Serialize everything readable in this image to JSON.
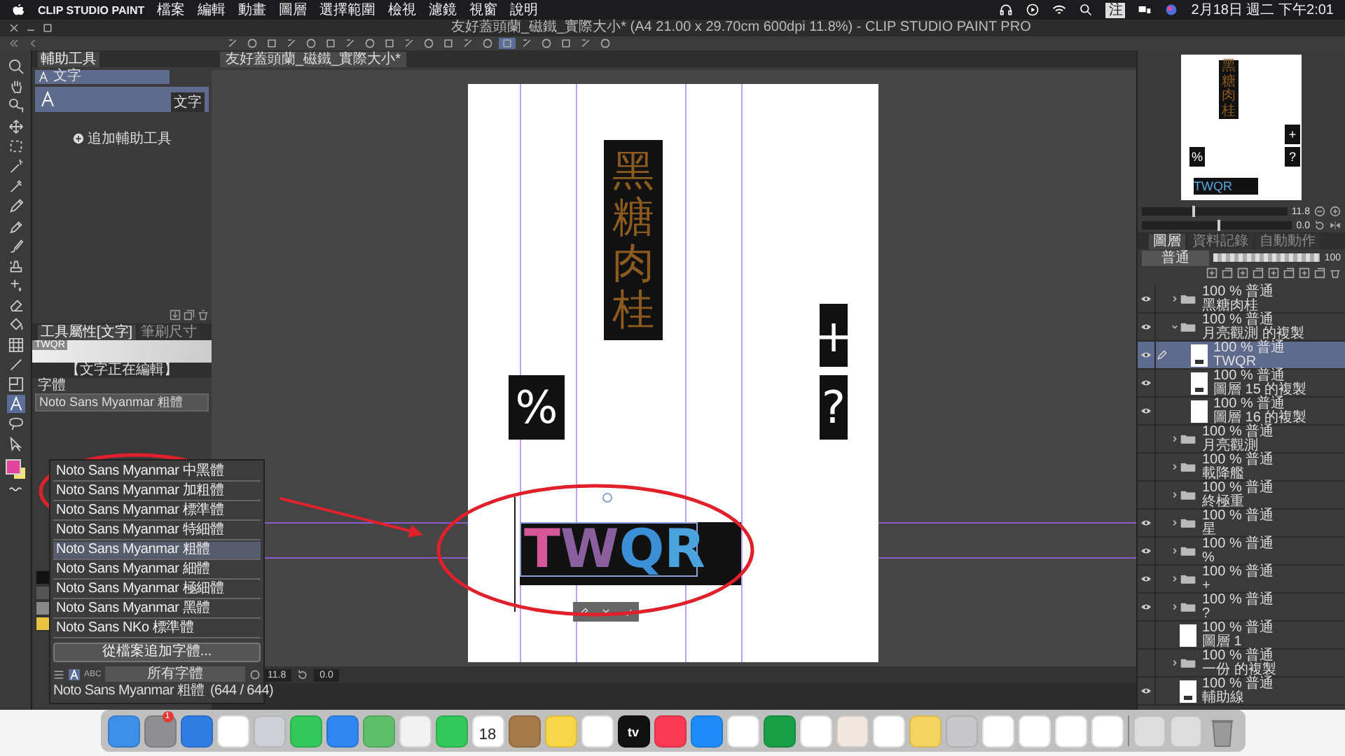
{
  "menubar": {
    "app": "CLIP STUDIO PAINT",
    "menus": [
      "檔案",
      "編輯",
      "動畫",
      "圖層",
      "選擇範圍",
      "檢視",
      "濾鏡",
      "視窗",
      "說明"
    ],
    "input_badge": "注",
    "clock": "2月18日 週二 下午2:01"
  },
  "window": {
    "title": "友好蓋頭蘭_磁鐵_實際大小* (A4 21.00 x 29.70cm 600dpi 11.8%) - CLIP STUDIO PAINT PRO"
  },
  "toolbox": [
    {
      "selected": false
    },
    {
      "selected": false
    },
    {
      "selected": false
    },
    {
      "selected": false
    },
    {
      "selected": false
    },
    {
      "selected": false
    },
    {
      "selected": false
    },
    {
      "selected": false
    },
    {
      "selected": false
    },
    {
      "selected": false
    },
    {
      "selected": false
    },
    {
      "selected": false
    },
    {
      "selected": false
    },
    {
      "selected": false
    },
    {
      "selected": false
    },
    {
      "selected": false
    },
    {
      "selected": false
    },
    {
      "selected": true
    },
    {
      "selected": false
    },
    {
      "selected": false
    }
  ],
  "sub_tool": {
    "tab": "輔助工具",
    "group": "文字",
    "items": [
      {
        "label": "文字",
        "selected": true
      }
    ],
    "add": "追加輔助工具"
  },
  "tool_property": {
    "tabs": [
      {
        "label": "工具屬性[文字]",
        "selected": true
      },
      {
        "label": "筆刷尺寸",
        "selected": false
      }
    ],
    "preview": "TWQR",
    "status": "【文字正在編輯】",
    "font_label": "字體",
    "font_value": "Noto Sans Myanmar 粗體"
  },
  "font_list": {
    "items": [
      {
        "label": "Noto Sans Myanmar 中黑體",
        "selected": false
      },
      {
        "label": "Noto Sans Myanmar 加粗體",
        "selected": false
      },
      {
        "label": "Noto Sans Myanmar 標準體",
        "selected": false
      },
      {
        "label": "Noto Sans Myanmar 特細體",
        "selected": false
      },
      {
        "label": "Noto Sans Myanmar 粗體",
        "selected": true
      },
      {
        "label": "Noto Sans Myanmar 細體",
        "selected": false
      },
      {
        "label": "Noto Sans Myanmar 極細體",
        "selected": false
      },
      {
        "label": "Noto Sans Myanmar 黑體",
        "selected": false
      },
      {
        "label": "Noto Sans NKo 標準體",
        "selected": false
      }
    ],
    "add_button": "從檔案追加字體...",
    "filter_prefix": "ABC",
    "filter": "所有字體",
    "current": "Noto Sans Myanmar 粗體",
    "count": "(644 / 644)"
  },
  "document_tab": "友好蓋頭蘭_磁鐵_實際大小*",
  "canvas": {
    "vertical_text": "黑糖肉桂",
    "percent": "%",
    "plus": "+",
    "question": "?",
    "letters": [
      {
        "char": "T",
        "color": "#d4579a"
      },
      {
        "char": "W",
        "color": "#8a5f9e"
      },
      {
        "char": "Q",
        "color": "#3b8fd4"
      },
      {
        "char": "R",
        "color": "#4aa3dc"
      }
    ]
  },
  "status_bar": {
    "zoom": "11.8",
    "angle": "0.0"
  },
  "navigator": {
    "vertical_text": "黑糖肉桂",
    "percent": "%",
    "plus": "+",
    "question": "?",
    "text": "TWQR",
    "zoom": "11.8",
    "zoom_slider": {
      "level": 0.35
    },
    "angle": "0.0",
    "angle_slider": {
      "level": 0.5
    }
  },
  "layer_panel": {
    "tabs": [
      {
        "label": "圖層",
        "selected": true
      },
      {
        "label": "資料記錄",
        "selected": false
      },
      {
        "label": "自動動作",
        "selected": false
      }
    ],
    "blend": "普通",
    "opacity": "100",
    "opacity_slider": {
      "level": 1
    },
    "layers": [
      {
        "kind": "folder",
        "opacity": "100 % 普通",
        "name": "黑糖肉桂",
        "visible": true,
        "expanded": false,
        "selected": false
      },
      {
        "kind": "folder",
        "opacity": "100 % 普通",
        "name": "月亮觀測 的複製",
        "visible": true,
        "expanded": true,
        "selected": false,
        "children": [
          {
            "kind": "text",
            "opacity": "100 % 普通",
            "name": "TWQR",
            "visible": true,
            "selected": true
          },
          {
            "kind": "text",
            "opacity": "100 % 普通",
            "name": "圖層 15 的複製",
            "visible": true,
            "selected": false
          },
          {
            "kind": "raster",
            "opacity": "100 % 普通",
            "name": "圖層 16 的複製",
            "visible": true,
            "selected": false
          }
        ]
      },
      {
        "kind": "folder",
        "opacity": "100 % 普通",
        "name": "月亮觀測",
        "visible": false,
        "expanded": false,
        "selected": false
      },
      {
        "kind": "folder",
        "opacity": "100 % 普通",
        "name": "載降艦",
        "visible": false,
        "expanded": false,
        "selected": false
      },
      {
        "kind": "folder",
        "opacity": "100 % 普通",
        "name": "終極重",
        "visible": false,
        "expanded": false,
        "selected": false
      },
      {
        "kind": "folder",
        "opacity": "100 % 普通",
        "name": "星",
        "visible": true,
        "expanded": false,
        "selected": false
      },
      {
        "kind": "folder",
        "opacity": "100 % 普通",
        "name": "%",
        "visible": true,
        "expanded": false,
        "selected": false
      },
      {
        "kind": "folder",
        "opacity": "100 % 普通",
        "name": "+",
        "visible": true,
        "expanded": false,
        "selected": false
      },
      {
        "kind": "folder",
        "opacity": "100 % 普通",
        "name": "?",
        "visible": true,
        "expanded": false,
        "selected": false
      },
      {
        "kind": "raster",
        "opacity": "100 % 普通",
        "name": "圖層 1",
        "visible": false,
        "selected": false
      },
      {
        "kind": "folder",
        "opacity": "100 % 普通",
        "name": "一份 的複製",
        "visible": false,
        "expanded": false,
        "selected": false
      },
      {
        "kind": "ruler",
        "opacity": "100 % 普通",
        "name": "輔助線",
        "visible": true,
        "selected": false
      }
    ]
  },
  "dock": {
    "badge": "1",
    "calendar_day": "18",
    "tv_label": "tv"
  }
}
